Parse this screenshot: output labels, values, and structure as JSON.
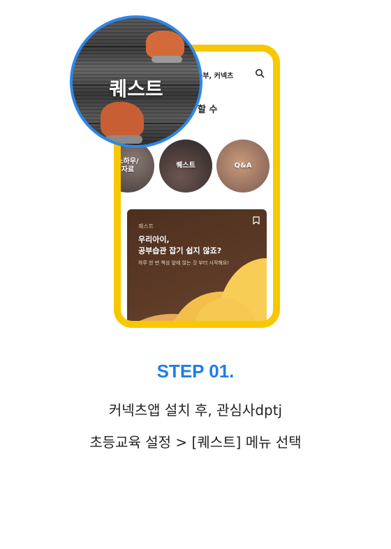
{
  "app": {
    "header_title": "공부, 커넥츠",
    "section_title": "할 수",
    "categories": [
      {
        "label": "노하우/\n자료"
      },
      {
        "label": "퀘스트"
      },
      {
        "label": "Q&A"
      }
    ],
    "card": {
      "tag": "퀘스트",
      "headline": "우리아이,\n공부습관 잡기 쉽지 않죠?",
      "description": "하루 한 번 책상 앞에 앉는 것 부터 시작해요!"
    }
  },
  "magnifier": {
    "label": "퀘스트"
  },
  "step": {
    "title": "STEP 01.",
    "line1": "커넥츠앱 설치 후, 관심사dptj",
    "line2": "초등교육 설정 > [퀘스트] 메뉴 선택"
  },
  "colors": {
    "phone_frame": "#f7c800",
    "magnifier_ring": "#2f86e8",
    "step_title": "#1d7ee8",
    "card_bg": "#5d3b27"
  }
}
